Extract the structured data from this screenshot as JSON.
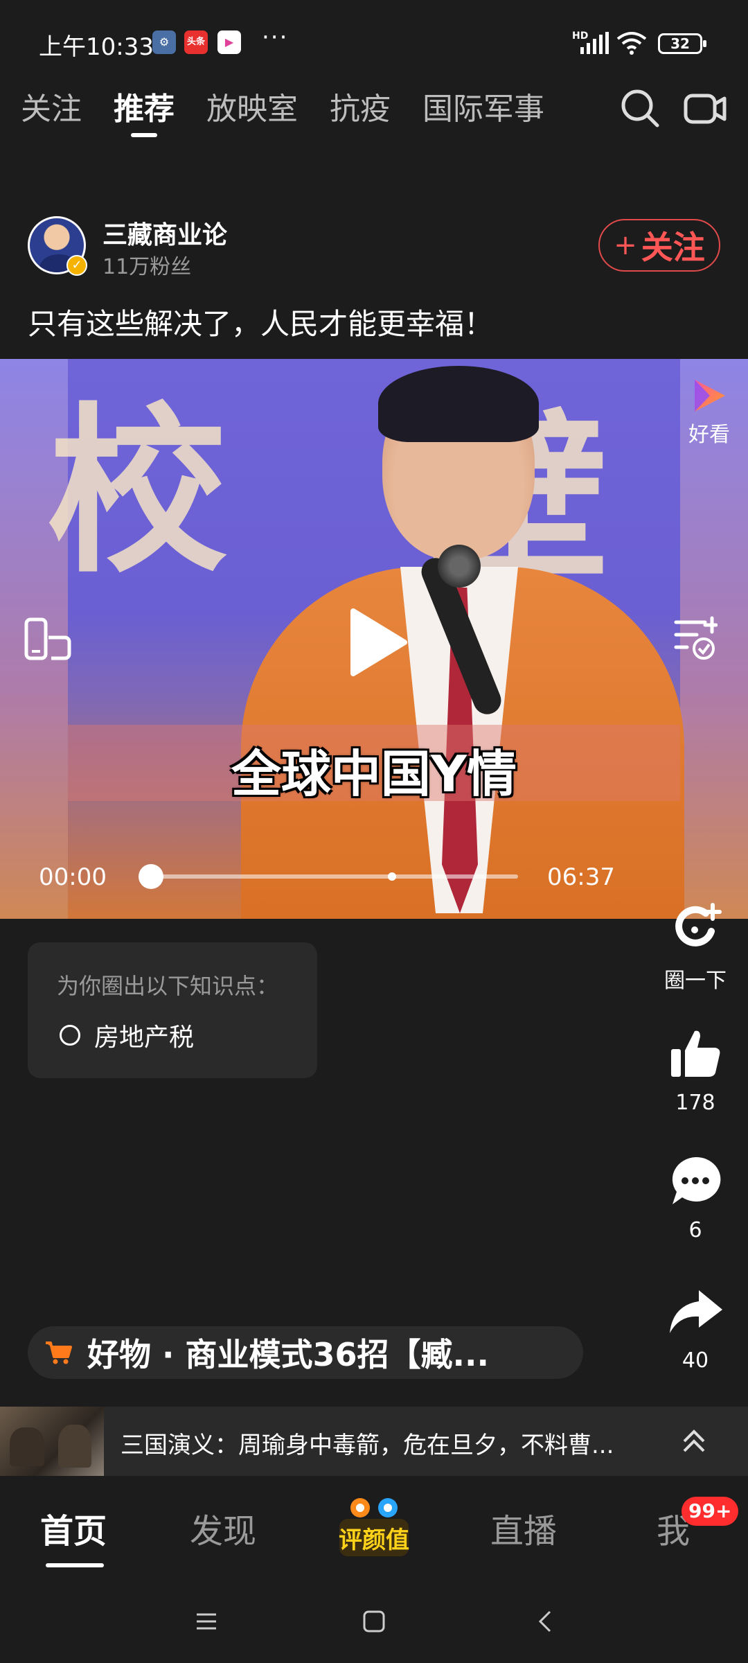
{
  "status_bar": {
    "time": "上午10:33",
    "notif_icons": [
      {
        "name": "settings-app-icon",
        "label": "⚙",
        "color": "#4a6fa5"
      },
      {
        "name": "toutiao-app-icon",
        "label": "头条",
        "color": "#e8312f"
      },
      {
        "name": "haokan-app-icon",
        "label": "▶",
        "color": "#ffffff"
      }
    ],
    "more": "···",
    "hd": "HD",
    "battery": "32"
  },
  "top_tabs": [
    {
      "label": "关注",
      "active": false
    },
    {
      "label": "推荐",
      "active": true
    },
    {
      "label": "放映室",
      "active": false
    },
    {
      "label": "抗疫",
      "active": false
    },
    {
      "label": "国际军事",
      "active": false
    }
  ],
  "author": {
    "name": "三藏商业论",
    "fans": "11万粉丝",
    "follow_label": "关注",
    "follow_plus": "+"
  },
  "video": {
    "title": "只有这些解决了，人民才能更幸福！",
    "subtitle": "全球中国Y情",
    "current_time": "00:00",
    "duration": "06:37",
    "progress": 0.0,
    "haokan_label": "好看"
  },
  "knowledge": {
    "heading": "为你圈出以下知识点：",
    "items": [
      "房地产税"
    ]
  },
  "actions": {
    "circle_label": "圈一下",
    "likes": "178",
    "comments": "6",
    "shares": "40"
  },
  "goods": {
    "text": "好物 · 商业模式36招【臧..."
  },
  "related": {
    "text": "三国演义：周瑜身中毒箭，危在旦夕，不料曹..."
  },
  "bottom_nav": {
    "items": [
      "首页",
      "发现",
      "直播",
      "我"
    ],
    "active": "首页",
    "center_logo_text": "评颜值",
    "badge": "99+"
  },
  "colors": {
    "background": "#1c1c1c",
    "follow_red": "#ff5656",
    "badge_red": "#ff2d2d",
    "cart_orange": "#ff7a1a"
  }
}
